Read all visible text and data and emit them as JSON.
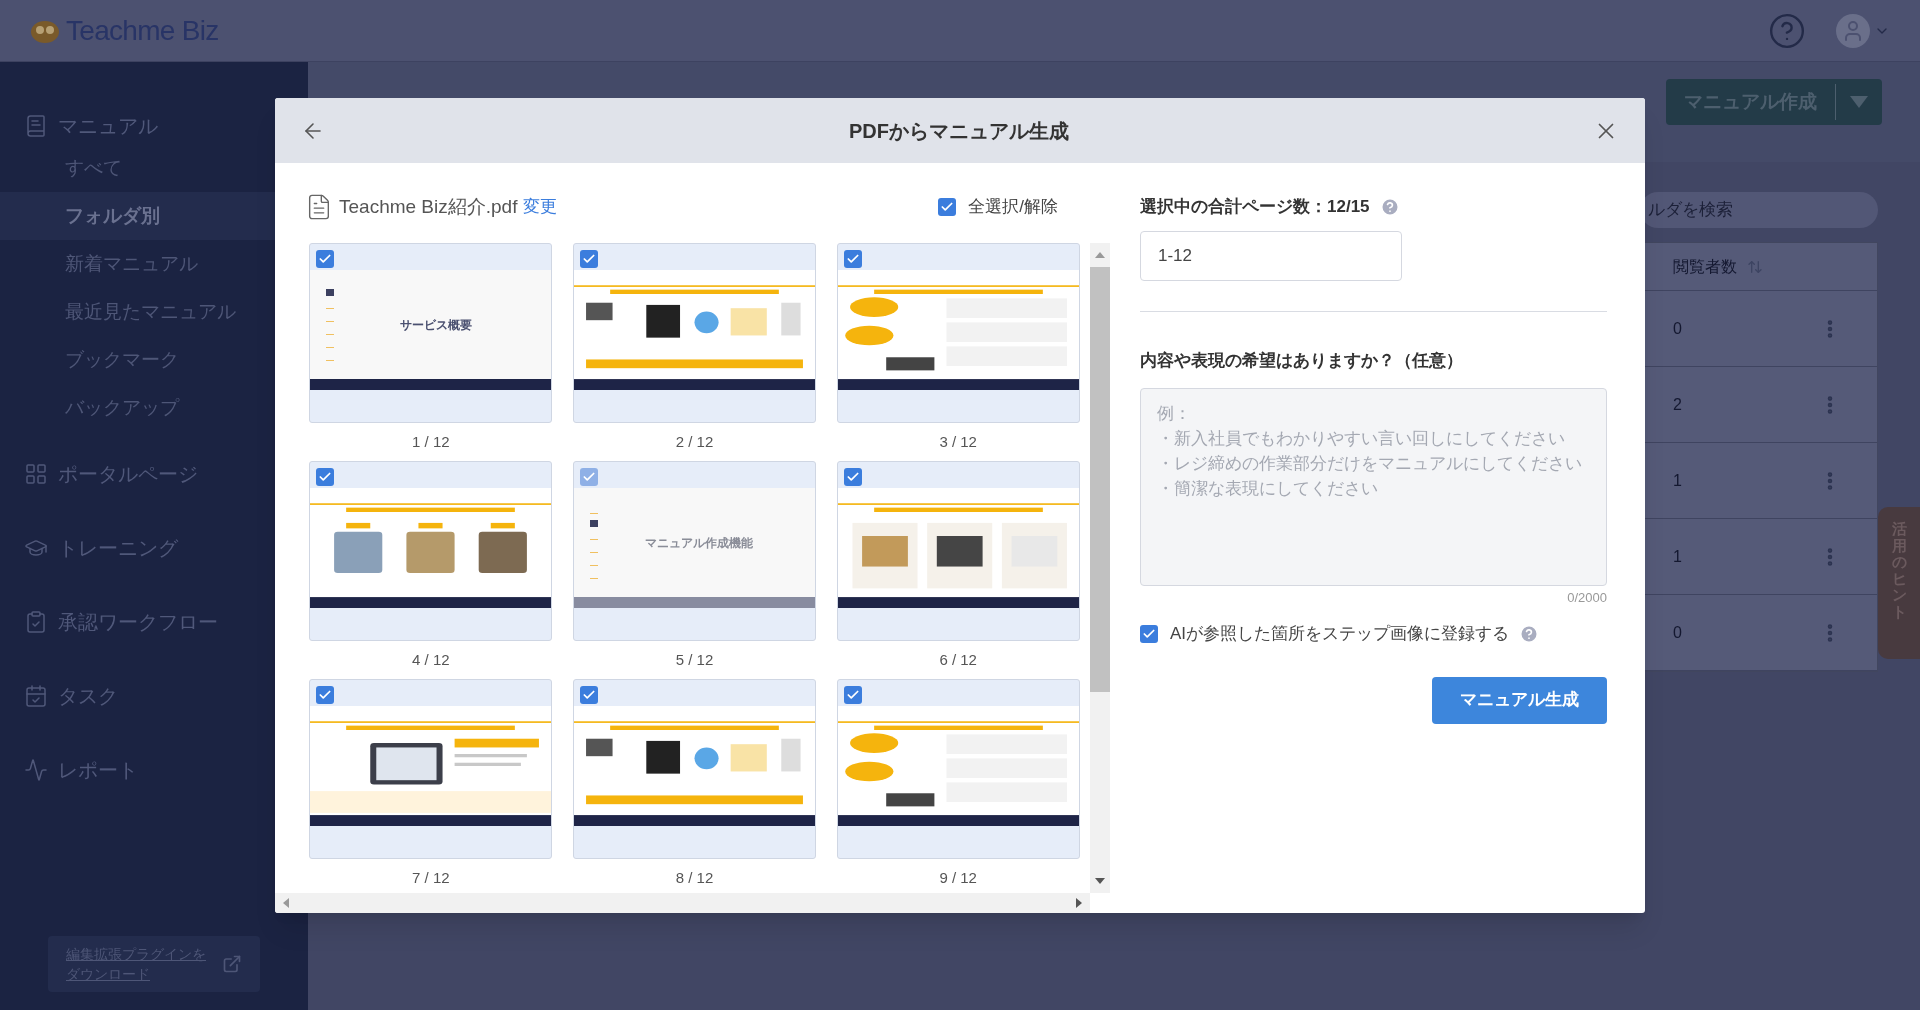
{
  "app": {
    "logo": "Teachme Biz"
  },
  "sidebar": {
    "sections": [
      {
        "label": "マニュアル",
        "children": [
          {
            "label": "すべて",
            "selected": false
          },
          {
            "label": "フォルダ別",
            "selected": true
          },
          {
            "label": "新着マニュアル",
            "selected": false
          },
          {
            "label": "最近見たマニュアル",
            "selected": false
          },
          {
            "label": "ブックマーク",
            "selected": false
          },
          {
            "label": "バックアップ",
            "selected": false
          }
        ]
      },
      {
        "label": "ポータルページ"
      },
      {
        "label": "トレーニング"
      },
      {
        "label": "承認ワークフロー"
      },
      {
        "label": "タスク"
      },
      {
        "label": "レポート"
      }
    ],
    "plugin_button": [
      "編集拡張プラグインを",
      "ダウンロード"
    ]
  },
  "background": {
    "create_button": "マニュアル作成",
    "search_placeholder": "ルダを検索",
    "table": {
      "columns": [
        "閲覧者数"
      ],
      "rows": [
        {
          "viewers": "0"
        },
        {
          "viewers": "2"
        },
        {
          "viewers": "1"
        },
        {
          "viewers": "1"
        },
        {
          "viewers": "0"
        }
      ]
    },
    "hint_tab": "活用のヒント"
  },
  "dialog": {
    "title": "PDFからマニュアル生成",
    "file": {
      "name": "Teachme Biz紹介.pdf",
      "change_link": "変更"
    },
    "select_all": {
      "label": "全選択/解除",
      "checked": true
    },
    "pages": [
      {
        "label": "1 / 12",
        "checked": true,
        "disabled": false,
        "title": "サービス概要"
      },
      {
        "label": "2 / 12",
        "checked": true,
        "disabled": false
      },
      {
        "label": "3 / 12",
        "checked": true,
        "disabled": false
      },
      {
        "label": "4 / 12",
        "checked": true,
        "disabled": false
      },
      {
        "label": "5 / 12",
        "checked": true,
        "disabled": true,
        "title": "マニュアル作成機能"
      },
      {
        "label": "6 / 12",
        "checked": true,
        "disabled": false
      },
      {
        "label": "7 / 12",
        "checked": true,
        "disabled": false
      },
      {
        "label": "8 / 12",
        "checked": true,
        "disabled": false
      },
      {
        "label": "9 / 12",
        "checked": true,
        "disabled": false
      }
    ],
    "page_count": "選択中の合計ページ数：12/15",
    "range_field": {
      "value": "1-12"
    },
    "request": {
      "label": "内容や表現の希望はありますか？（任意）",
      "placeholder": [
        "例：",
        "・新入社員でもわかりやすい言い回しにしてください",
        "・レジ締めの作業部分だけをマニュアルにしてください",
        "・簡潔な表現にしてください"
      ],
      "counter": "0/2000"
    },
    "ai_option": {
      "label": "AIが参照した箇所をステップ画像に登録する",
      "checked": true
    },
    "submit": "マニュアル生成"
  }
}
